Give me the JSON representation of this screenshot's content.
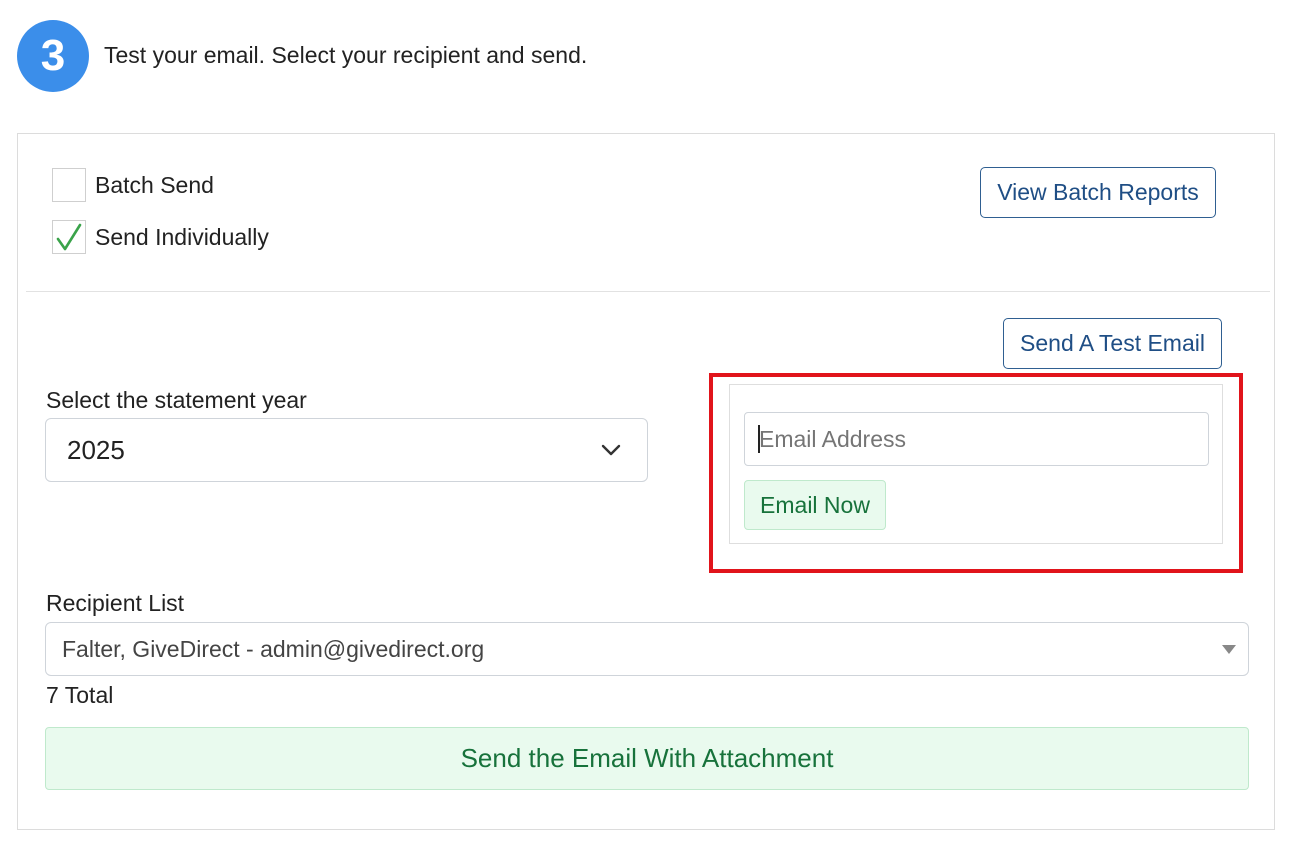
{
  "step": {
    "number": "3",
    "instruction": "Test your email. Select your recipient and send."
  },
  "send_mode": {
    "batch_label": "Batch Send",
    "batch_checked": false,
    "individual_label": "Send Individually",
    "individual_checked": true,
    "view_reports_label": "View Batch Reports"
  },
  "test_email": {
    "button_label": "Send A Test Email",
    "email_placeholder": "Email Address",
    "email_value": "",
    "email_now_label": "Email Now"
  },
  "statement_year": {
    "label": "Select the statement year",
    "selected": "2025"
  },
  "recipients": {
    "label": "Recipient List",
    "selected": "Falter, GiveDirect - admin@givedirect.org",
    "total_text": "7 Total"
  },
  "send_button_label": "Send the Email With Attachment",
  "colors": {
    "badge": "#3b8eea",
    "highlight": "#e1141b",
    "green_text": "#17723b",
    "green_bg": "#e9faee",
    "check": "#3aa34a"
  },
  "icons": {
    "checkmark": "check-icon",
    "year_dropdown": "chevron-down-icon",
    "recipient_dropdown": "caret-down-icon"
  }
}
